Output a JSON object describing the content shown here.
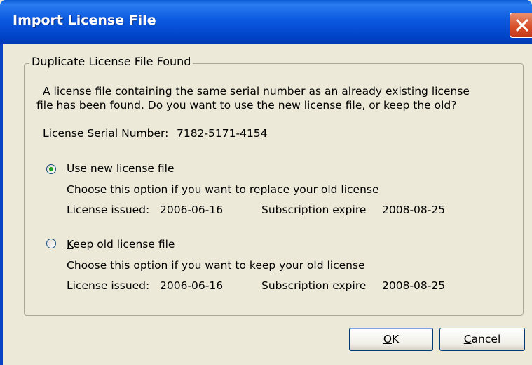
{
  "window": {
    "title": "Import License File"
  },
  "group": {
    "legend": "Duplicate License File Found"
  },
  "message": {
    "line1": "A license file containing the same serial number as an already existing license",
    "line2": "file has been found. Do you want to use the new license file, or keep the old?"
  },
  "serial": {
    "label": "License Serial Number:",
    "value": "7182-5171-4154"
  },
  "options": [
    {
      "mnemonic": "U",
      "label_rest": "se new license file",
      "selected": true,
      "description": "Choose this option if you want to replace your old license",
      "issued_label": "License issued:",
      "issued_value": "2006-06-16",
      "expire_label": "Subscription expire",
      "expire_value": "2008-08-25"
    },
    {
      "mnemonic": "K",
      "label_rest": "eep old license file",
      "selected": false,
      "description": "Choose this option if you want to keep your old license",
      "issued_label": "License issued:",
      "issued_value": "2006-06-16",
      "expire_label": "Subscription expire",
      "expire_value": "2008-08-25"
    }
  ],
  "buttons": {
    "ok": {
      "mnemonic": "O",
      "rest": "K"
    },
    "cancel": {
      "mnemonic": "C",
      "rest": "ancel"
    }
  }
}
